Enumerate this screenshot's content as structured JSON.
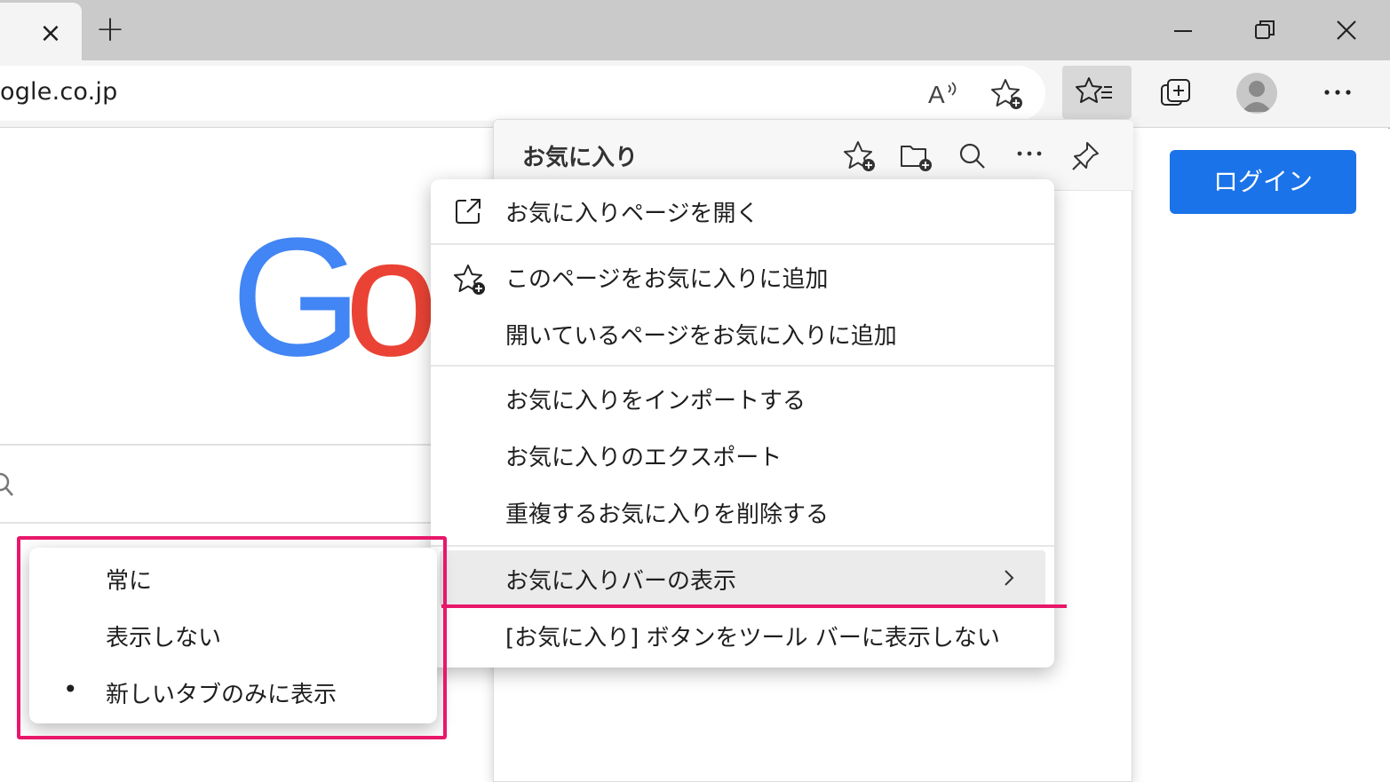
{
  "browser": {
    "tab_close": "×",
    "new_tab": "+",
    "url": "ogle.co.jp"
  },
  "toolbar_icons": [
    "read-aloud-icon",
    "add-favorite-icon",
    "favorites-icon",
    "collections-icon",
    "profile-avatar",
    "more-icon"
  ],
  "page": {
    "login_label": "ログイン",
    "logo_letters": [
      "G",
      "o"
    ],
    "logo_colors": {
      "G": "#4285f4",
      "o": "#ea4335"
    }
  },
  "favorites_panel": {
    "title": "お気に入り"
  },
  "menu": {
    "items": [
      {
        "label": "お気に入りページを開く",
        "icon": "open-external-icon"
      },
      {
        "label": "このページをお気に入りに追加",
        "icon": "add-favorite-icon"
      },
      {
        "label": "開いているページをお気に入りに追加"
      },
      {
        "label": "お気に入りをインポートする"
      },
      {
        "label": "お気に入りのエクスポート"
      },
      {
        "label": "重複するお気に入りを削除する"
      },
      {
        "label": "お気に入りバーの表示",
        "submenu": true
      },
      {
        "label": "[お気に入り] ボタンをツール バーに表示しない"
      }
    ]
  },
  "submenu": {
    "items": [
      {
        "label": "常に",
        "selected": false
      },
      {
        "label": "表示しない",
        "selected": false
      },
      {
        "label": "新しいタブのみに表示",
        "selected": true
      }
    ],
    "bullet": "•"
  },
  "annotation_color": "#e8176a"
}
